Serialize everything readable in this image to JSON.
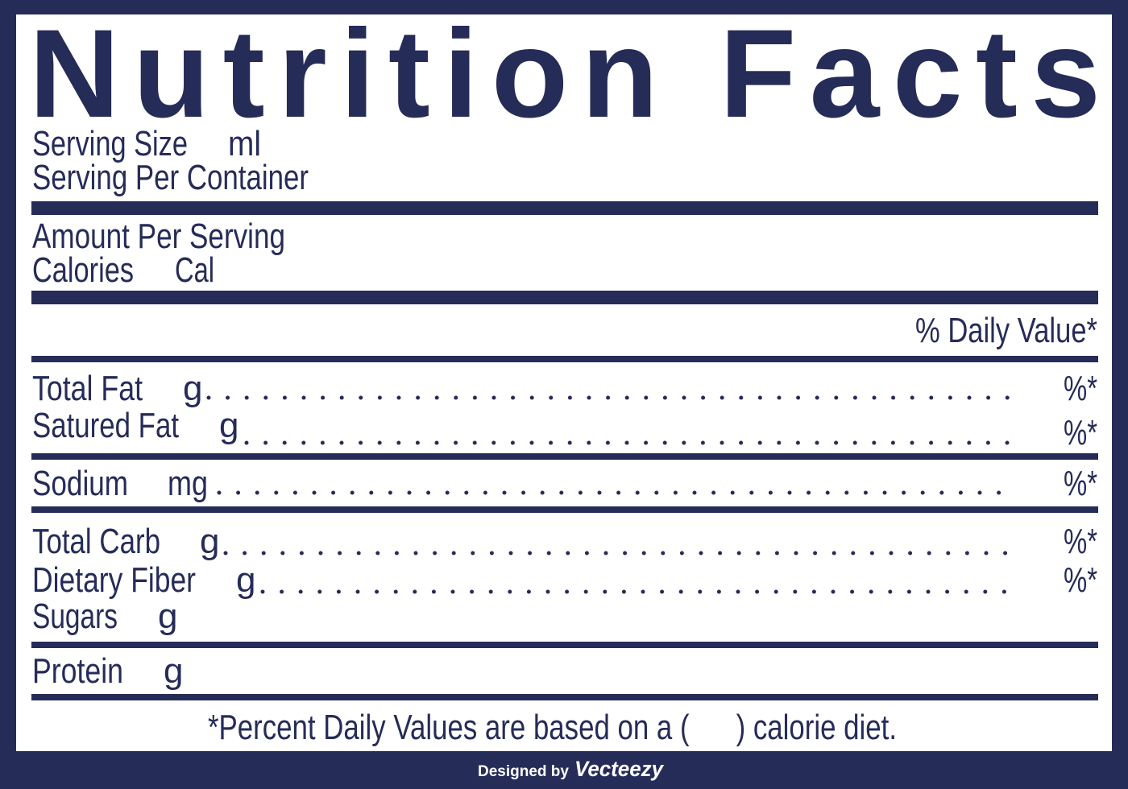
{
  "title": "Nutrition Facts",
  "serving": {
    "size_label": "Serving Size",
    "size_unit": "ml",
    "per_container_label": "Serving Per Container"
  },
  "amount": {
    "label": "Amount Per Serving",
    "calories_label": "Calories",
    "calories_unit": "Cal"
  },
  "daily_value_header": "% Daily Value*",
  "nutrients": [
    {
      "label": "Total Fat",
      "unit": "g",
      "dv": "%*"
    },
    {
      "label": "Satured Fat",
      "unit": "g",
      "dv": "%*"
    },
    {
      "label": "Sodium",
      "unit": "mg",
      "dv": "%*"
    },
    {
      "label": "Total Carb",
      "unit": "g",
      "dv": "%*"
    },
    {
      "label": "Dietary Fiber",
      "unit": "g",
      "dv": "%*"
    },
    {
      "label": "Sugars",
      "unit": "g"
    },
    {
      "label": "Protein",
      "unit": "g"
    }
  ],
  "footnote": "*Percent Daily Values are based on a (      ) calorie diet.",
  "credit": {
    "prefix": "Designed by",
    "brand": "Vecteezy"
  },
  "colors": {
    "navy": "#262c58",
    "panel": "#ffffff"
  }
}
